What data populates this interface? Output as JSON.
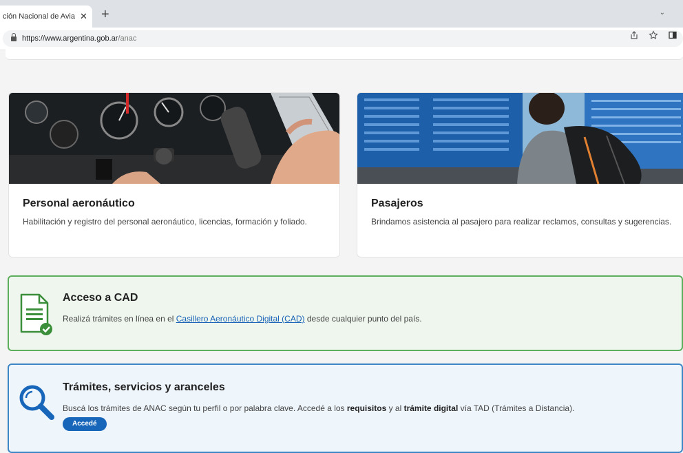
{
  "browser": {
    "tab_title": "ción Nacional de Avia",
    "tab_close": "✕",
    "new_tab": "+",
    "tab_menu": "⌄",
    "url_host": "https://www.argentina.gob.ar",
    "url_path": "/anac",
    "toolbar_icons": [
      "share-icon",
      "star-icon",
      "sidepanel-icon"
    ]
  },
  "cards": [
    {
      "title": "Personal aeronáutico",
      "description": "Habilitación y registro del personal aeronáutico, licencias, formación y foliado.",
      "image": "cockpit-photo"
    },
    {
      "title": "Pasajeros",
      "description": "Brindamos asistencia al pasajero para realizar reclamos, consultas y sugerencias.",
      "image": "airport-departures-photo"
    }
  ],
  "cad": {
    "title": "Acceso a CAD",
    "text_before": "Realizá trámites en línea en el ",
    "link": "Casillero Aeronáutico Digital (CAD)",
    "text_after": " desde cualquier punto del país.",
    "icon": "document-check-icon",
    "accent": "#5cae5c"
  },
  "tramites": {
    "title": "Trámites, servicios y aranceles",
    "text_1": "Buscá los trámites de ANAC según tu perfil o por palabra clave. Accedé a los ",
    "bold_1": "requisitos",
    "text_2": " y al ",
    "bold_2": "trámite digital",
    "text_3": " vía TAD (Trámites a Distancia).",
    "button": "Accedé",
    "icon": "search-icon",
    "accent": "#1866b9"
  }
}
